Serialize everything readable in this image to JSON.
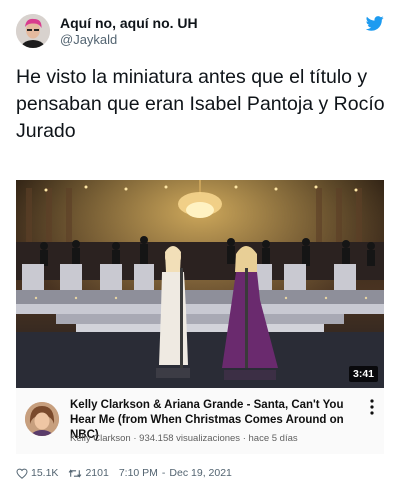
{
  "tweet": {
    "author_name": "Aquí no, aquí no. UH",
    "author_handle": "@Jaykald",
    "text": "He visto la miniatura antes que el título y pensaban que eran Isabel Pantoja y Rocío Jurado",
    "likes": "15.1K",
    "retweets": "2101",
    "time": "7:10 PM",
    "separator": "-",
    "date": "Dec 19, 2021"
  },
  "video": {
    "title": "Kelly Clarkson & Ariana Grande - Santa, Can't You Hear Me (from When Christmas Comes Around on NBC)",
    "channel": "Kelly Clarkson",
    "views": "934.158 visualizaciones",
    "age": "hace 5 días",
    "duration": "3:41"
  },
  "icons": {
    "brand": "twitter-bird-icon",
    "like": "heart-icon",
    "retweet": "retweet-icon",
    "more": "more-vertical-icon"
  },
  "colors": {
    "twitter_blue": "#1d9bf0",
    "secondary_text": "#536471",
    "primary_text": "#0f1419"
  }
}
